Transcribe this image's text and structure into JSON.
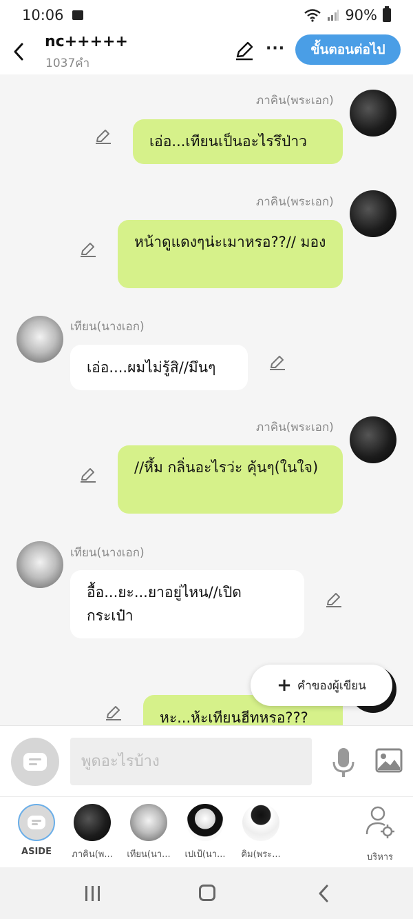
{
  "status_bar": {
    "time": "10:06",
    "battery": "90%"
  },
  "header": {
    "title": "nc+++++",
    "word_count": "1037คำ",
    "next_button": "ขั้นตอนต่อไป"
  },
  "messages": [
    {
      "side": "right",
      "speaker": "ภาคิน(พระเอก)",
      "text": "เอ่อ...เทียนเป็นอะไรรึป่าว"
    },
    {
      "side": "right",
      "speaker": "ภาคิน(พระเอก)",
      "text": "หน้าดูแดงๆน่ะเมาหรอ??// มอง"
    },
    {
      "side": "left",
      "speaker": "เทียน(นางเอก)",
      "text": "เอ่อ....ผมไม่รู้สิ//มึนๆ"
    },
    {
      "side": "right",
      "speaker": "ภาคิน(พระเอก)",
      "text": "//หึ้ม กลิ่นอะไรว่ะ คุ้นๆ(ในใจ)"
    },
    {
      "side": "left",
      "speaker": "เทียน(นางเอก)",
      "text": "อื้อ...ยะ...ยาอยู่ไหน//เปิด กระเป๋า"
    },
    {
      "side": "right",
      "speaker": "",
      "text": "หะ...ห้ะเทียนฮีทหรอ???"
    }
  ],
  "author_note_button": "คำของผู้เขียน",
  "input": {
    "placeholder": "พูดอะไรบ้าง"
  },
  "characters": [
    {
      "label": "ASIDE"
    },
    {
      "label": "ภาคิน(พ..."
    },
    {
      "label": "เทียน(นา..."
    },
    {
      "label": "เปเป้(นา..."
    },
    {
      "label": "คิม(พระ..."
    }
  ],
  "manage_label": "บริหาร",
  "icons": {
    "back": "chevron-left-icon",
    "edit": "pencil-icon",
    "more": "more-dots-icon",
    "mic": "microphone-icon",
    "image": "image-icon",
    "manage": "user-settings-icon"
  }
}
